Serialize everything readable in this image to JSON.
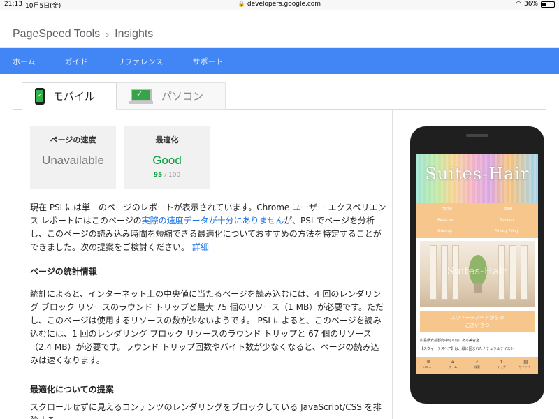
{
  "status_bar": {
    "time": "21:13",
    "date": "10月5日(金)",
    "url": "developers.google.com",
    "battery": "36%",
    "battery_level": 0.36
  },
  "header": {
    "crumb_root": "PageSpeed Tools",
    "crumb_separator": "›",
    "crumb_current": "Insights"
  },
  "nav": {
    "items": [
      "ホーム",
      "ガイド",
      "リファレンス",
      "サポート"
    ]
  },
  "tabs": {
    "mobile": "モバイル",
    "desktop": "パソコン"
  },
  "cards": {
    "speed": {
      "title": "ページの速度",
      "value": "Unavailable"
    },
    "optimization": {
      "title": "最適化",
      "value": "Good",
      "score": "95",
      "score_max": "/ 100"
    }
  },
  "intro": {
    "text_a": "現在 PSI には単一のページのレポートが表示されています。Chrome ユーザー エクスペリエンス レポートにはこのページの",
    "link_a": "実際の速度データが十分にありません",
    "text_b": "が、PSI でページを分析し、このページの読み込み時間を短縮できる最適化についておすすめの方法を特定することができました。次の提案をご検討ください。",
    "link_b": "詳細"
  },
  "stats": {
    "heading": "ページの統計情報",
    "body": "統計によると、インターネット上の中央値に当たるページを読み込むには、4 回のレンダリング ブロック リソースのラウンド トリップと最大 75 個のリソース（1 MB）が必要です。ただし、このページは使用するリソースの数が少ないようです。 PSI によると、このページを読み込むには、1 回のレンダリング ブロック リソースのラウンド トリップと 67 個のリソース（2.4 MB）が必要です。ラウンド トリップ回数やバイト数が少なくなると、ページの読み込みは速くなります。"
  },
  "suggestions": {
    "heading": "最適化についての提案",
    "body": "スクロールせずに見えるコンテンツのレンダリングをブロックしている JavaScript/CSS を排除する"
  },
  "preview": {
    "site_logo": "Suites-Hair",
    "menu": [
      "Home",
      "Blog",
      "About us",
      "Contact",
      "Sitemap",
      "Privacy Policy"
    ],
    "photo_watermark": "Suites-Hair",
    "greeting": "スウィーテスヘアからの\nごあいさつ",
    "text1": "広島県安芸郡府中町本町にある美容室",
    "text2": "【スウィーテスヘア】は、緑に囲まれたナチュラルテイスト",
    "footer": [
      "メニュー",
      "ホーム",
      "検索",
      "トップ",
      "サイドバー"
    ]
  },
  "icons": {
    "status": [
      "lock-icon",
      "wifi-icon",
      "battery-icon"
    ],
    "tabs": [
      "phone-icon",
      "monitor-icon"
    ],
    "footer": [
      "menu-icon",
      "home-icon",
      "search-icon",
      "arrow-up-icon",
      "sidebar-icon"
    ]
  },
  "colors": {
    "nav_blue": "#4285f4",
    "good_green": "#0c9d3f",
    "link_blue": "#1a73e8",
    "preview_orange": "#f7c68c"
  }
}
